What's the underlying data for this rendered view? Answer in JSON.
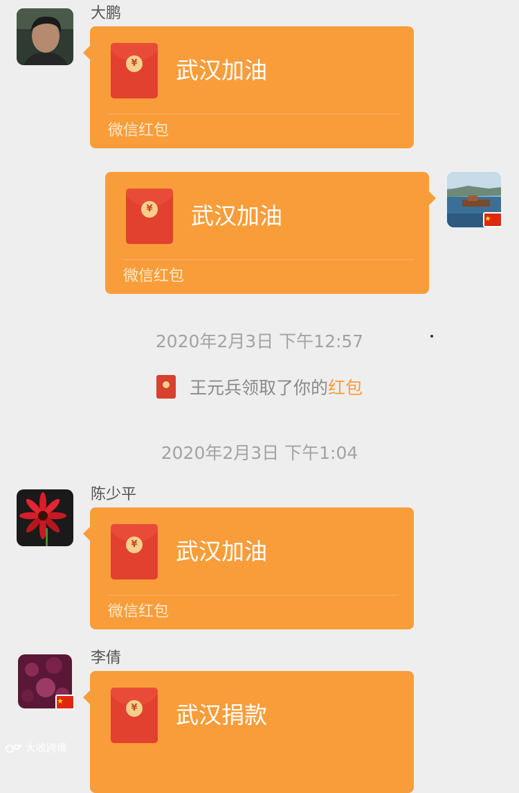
{
  "messages": [
    {
      "sender": "大鹏",
      "title": "武汉加油",
      "footer": "微信红包"
    },
    {
      "sender": "",
      "title": "武汉加油",
      "footer": "微信红包"
    },
    {
      "sender": "陈少平",
      "title": "武汉加油",
      "footer": "微信红包"
    },
    {
      "sender": "李倩",
      "title": "武汉捐款",
      "footer": ""
    }
  ],
  "timestamps": [
    "2020年2月3日 下午12:57",
    "2020年2月3日 下午1:04"
  ],
  "system_message": {
    "prefix": "王元兵领取了你的",
    "highlight": "红包",
    "icon": "red-packet-icon"
  },
  "envelope": {
    "currency_symbol": "¥",
    "icon": "red-packet-icon"
  },
  "watermark": "大收跨境",
  "colors": {
    "background": "#eeeeee",
    "bubble": "#f99d3a",
    "envelope": "#e2412f",
    "highlight": "#f99d3a"
  }
}
